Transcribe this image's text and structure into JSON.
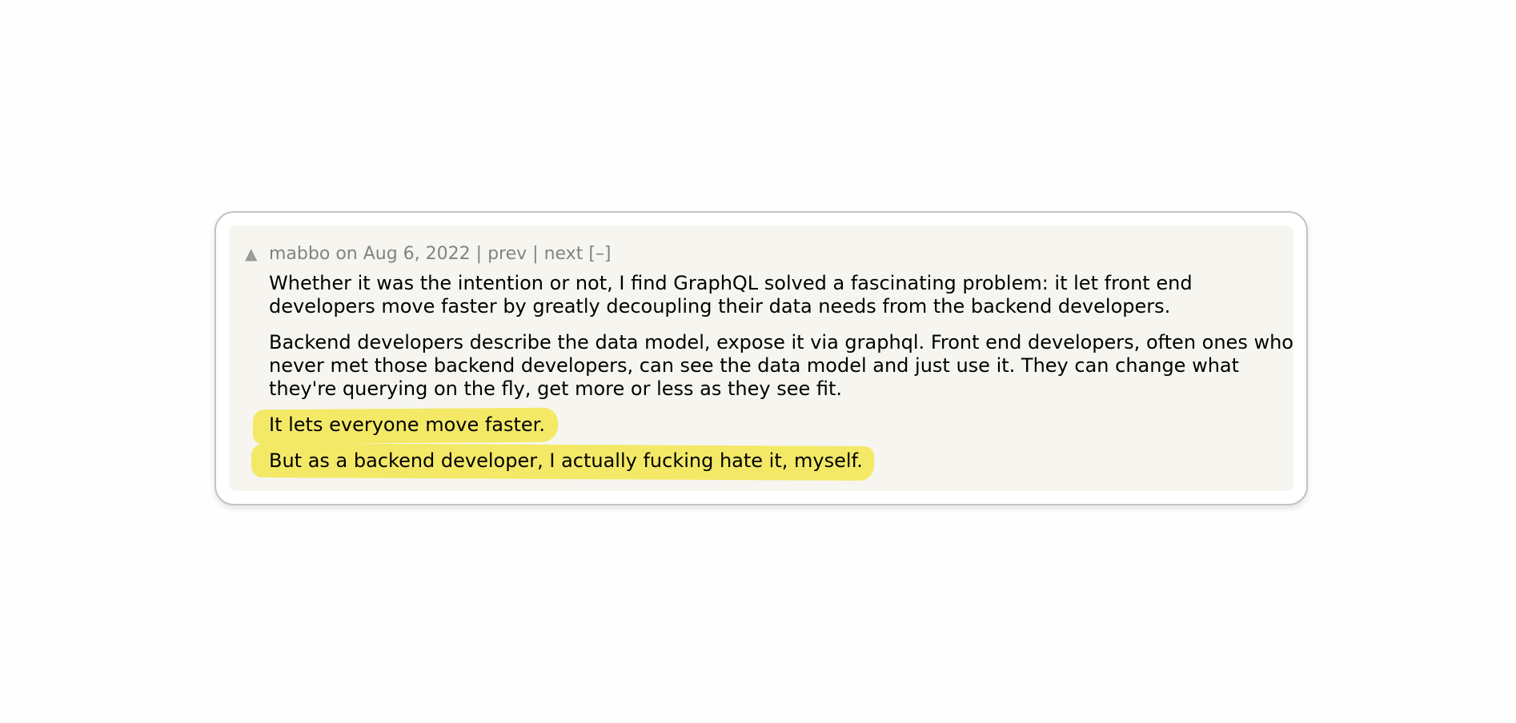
{
  "comment": {
    "vote_icon": "upvote-triangle-icon",
    "vote_glyph": "▲",
    "author": "mabbo",
    "on_text": "on",
    "date": "Aug 6, 2022",
    "separator": "|",
    "prev_label": "prev",
    "next_label": "next",
    "collapse_label": "[–]",
    "highlight_color": "#f3e966",
    "paragraphs": [
      "Whether it was the intention or not, I find GraphQL solved a fascinating problem: it let front end developers move faster by greatly decoupling their data needs from the backend developers.",
      "Backend developers describe the data model, expose it via graphql. Front end developers, often ones who never met those backend developers, can see the data model and just use it. They can change what they're querying on the fly, get more or less as they see fit.",
      "It lets everyone move faster.",
      "But as a backend developer, I actually fucking hate it, myself."
    ]
  }
}
